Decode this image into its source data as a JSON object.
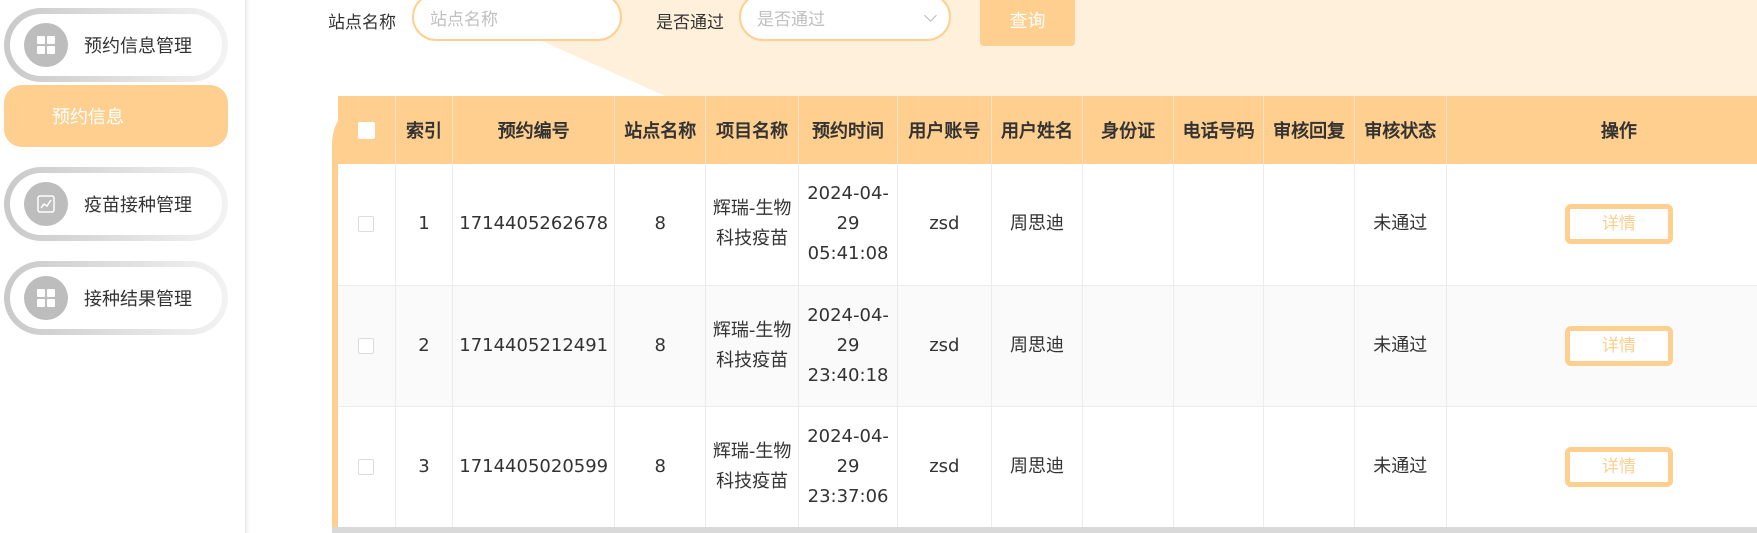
{
  "sidebar": {
    "menu": [
      {
        "label": "预约信息管理",
        "icon": "grid-icon"
      },
      {
        "label": "疫苗接种管理",
        "icon": "chart-icon"
      },
      {
        "label": "接种结果管理",
        "icon": "grid-icon"
      }
    ],
    "active_sub_item": "预约信息"
  },
  "search": {
    "site_label": "站点名称",
    "site_placeholder": "站点名称",
    "pass_label": "是否通过",
    "pass_placeholder": "是否通过",
    "query_label": "查询"
  },
  "table": {
    "headers": [
      "索引",
      "预约编号",
      "站点名称",
      "项目名称",
      "预约时间",
      "用户账号",
      "用户姓名",
      "身份证",
      "电话号码",
      "审核回复",
      "审核状态",
      "操作"
    ],
    "rows": [
      {
        "index": "1",
        "booking_no": "1714405262678",
        "site": "8",
        "project": "辉瑞-生物科技疫苗",
        "time": "2024-04-29 05:41:08",
        "account": "zsd",
        "name": "周思迪",
        "id_card": "",
        "phone": "",
        "reply": "",
        "status": "未通过",
        "action": "详情"
      },
      {
        "index": "2",
        "booking_no": "1714405212491",
        "site": "8",
        "project": "辉瑞-生物科技疫苗",
        "time": "2024-04-29 23:40:18",
        "account": "zsd",
        "name": "周思迪",
        "id_card": "",
        "phone": "",
        "reply": "",
        "status": "未通过",
        "action": "详情"
      },
      {
        "index": "3",
        "booking_no": "1714405020599",
        "site": "8",
        "project": "辉瑞-生物科技疫苗",
        "time": "2024-04-29 23:37:06",
        "account": "zsd",
        "name": "周思迪",
        "id_card": "",
        "phone": "",
        "reply": "",
        "status": "未通过",
        "action": "详情"
      }
    ]
  },
  "colors": {
    "accent": "#fecf8f",
    "header_bg": "#fff0dc",
    "sidebar_icon_bg": "#bdbdbd"
  }
}
